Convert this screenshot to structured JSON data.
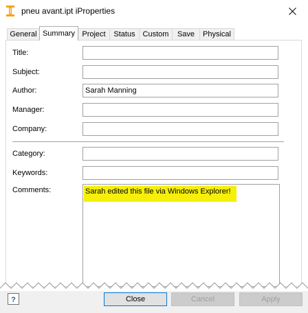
{
  "window": {
    "title": "pneu avant.ipt iProperties"
  },
  "tabs": [
    "General",
    "Summary",
    "Project",
    "Status",
    "Custom",
    "Save",
    "Physical"
  ],
  "active_tab": "Summary",
  "fields": {
    "title": {
      "label": "Title:",
      "value": ""
    },
    "subject": {
      "label": "Subject:",
      "value": ""
    },
    "author": {
      "label": "Author:",
      "value": "Sarah Manning"
    },
    "manager": {
      "label": "Manager:",
      "value": ""
    },
    "company": {
      "label": "Company:",
      "value": ""
    },
    "category": {
      "label": "Category:",
      "value": ""
    },
    "keywords": {
      "label": "Keywords:",
      "value": ""
    },
    "comments": {
      "label": "Comments:",
      "value": "Sarah edited this file via Windows Explorer!"
    }
  },
  "buttons": {
    "close": "Close",
    "cancel": "Cancel",
    "apply": "Apply"
  },
  "colors": {
    "highlight": "#f5ef0a",
    "app_icon": "#f7a21b"
  },
  "icons": {
    "app": "inventor-i-icon",
    "close": "close-icon",
    "help": "help-icon"
  }
}
